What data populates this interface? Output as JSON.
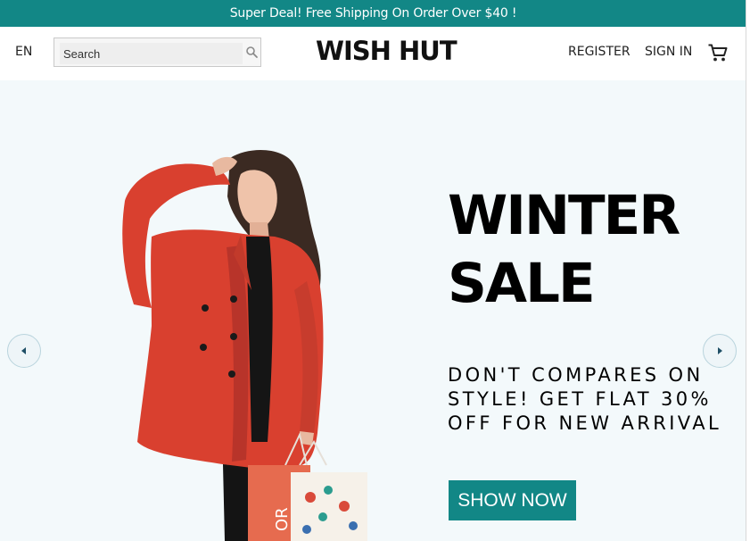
{
  "announcement": {
    "text": "Super Deal! Free Shipping On Order Over $40 !"
  },
  "header": {
    "language": "EN",
    "search": {
      "placeholder": "Search",
      "value": ""
    },
    "logo": "WISH HUT",
    "links": {
      "register": "REGISTER",
      "sign_in": "SIGN IN"
    }
  },
  "hero": {
    "title_line1": "WINTER",
    "title_line2": "SALE",
    "desc_line1": "DON'T COMPARES ON",
    "desc_line2": "STYLE! GET FLAT 30%",
    "desc_line3": "OFF FOR NEW ARRIVAL",
    "cta": "SHOW NOW",
    "bag_text": "OR"
  },
  "icons": {
    "search": "search-icon",
    "cart": "shopping-cart-icon",
    "prev": "caret-left-icon",
    "next": "caret-right-icon"
  },
  "colors": {
    "accent": "#128786",
    "hero_bg": "#f3f9fb",
    "coat": "#d9402f",
    "text": "#000000"
  }
}
